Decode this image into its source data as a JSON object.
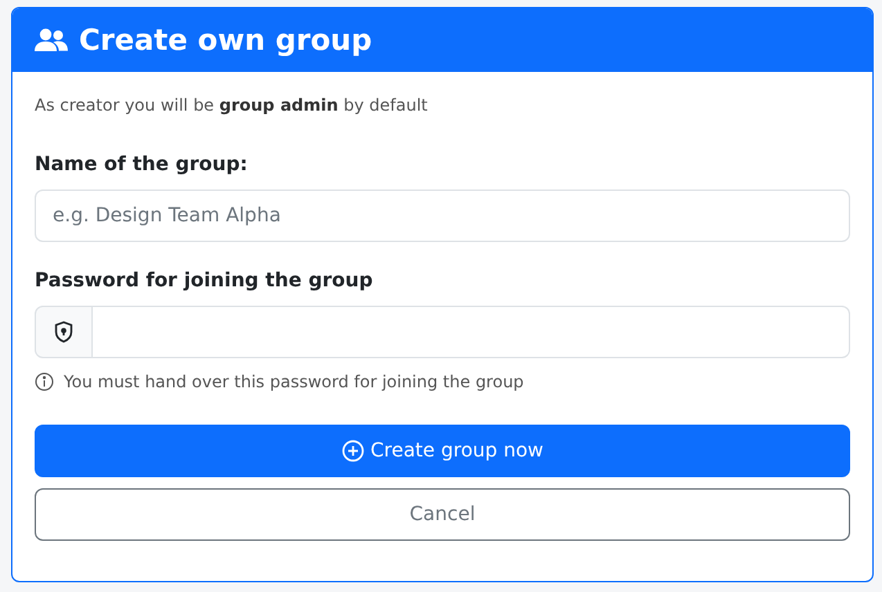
{
  "header": {
    "title": "Create own group"
  },
  "intro": "As creator you will be **group admin** by default",
  "name_field": {
    "label": "Name of the group:",
    "placeholder": "e.g. Design Team Alpha"
  },
  "password_field": {
    "label": "Password for joining the group"
  },
  "hint": "You must hand over this password for joining the group",
  "buttons": [
    {
      "kind": "primary",
      "label": "Create group now"
    },
    {
      "kind": "secondary",
      "label": "Cancel"
    }
  ]
}
